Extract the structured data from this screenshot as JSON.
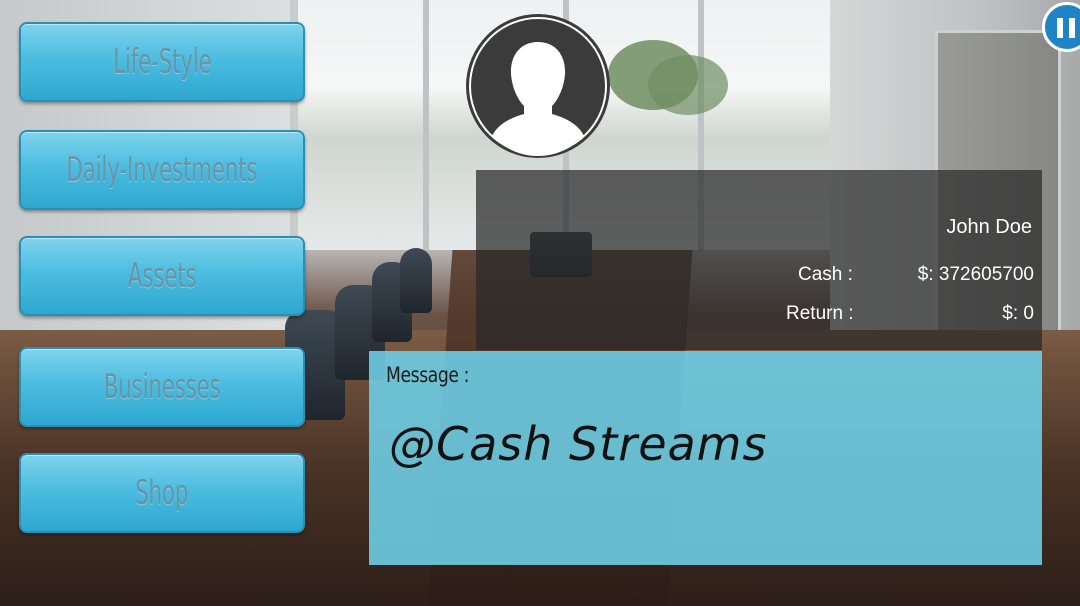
{
  "menu": {
    "items": [
      {
        "id": "life-style",
        "label": "Life-Style"
      },
      {
        "id": "daily-investments",
        "label": "Daily-Investments"
      },
      {
        "id": "assets",
        "label": "Assets"
      },
      {
        "id": "businesses",
        "label": "Businesses"
      },
      {
        "id": "shop",
        "label": "Shop"
      }
    ]
  },
  "player": {
    "avatar_icon": "user-silhouette-icon",
    "name": "John Doe",
    "cash_label": "Cash :",
    "cash_value": "$: 372605700",
    "return_label": "Return :",
    "return_value": "$: 0"
  },
  "message": {
    "title": "Message :",
    "body": "@Cash Streams"
  },
  "controls": {
    "pause_icon": "pause-icon"
  },
  "colors": {
    "button_blue": "#4cbde0",
    "message_panel": "#6ed0e8",
    "pause_blue": "#1e84c6"
  }
}
